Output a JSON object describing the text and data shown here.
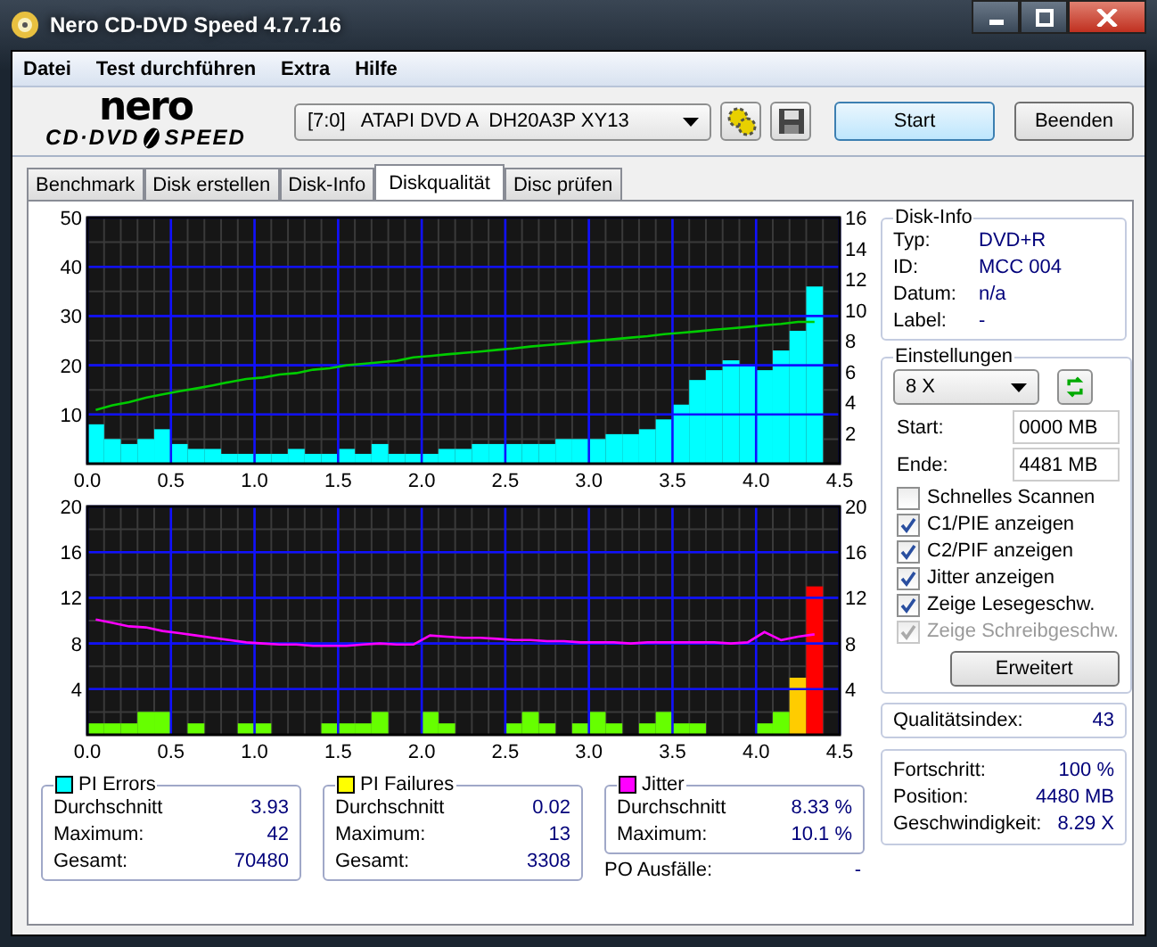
{
  "window": {
    "title": "Nero CD-DVD Speed 4.7.7.16"
  },
  "menu": [
    {
      "label": "Datei"
    },
    {
      "label": "Test durchführen"
    },
    {
      "label": "Extra"
    },
    {
      "label": "Hilfe"
    }
  ],
  "logo": {
    "top": "nero",
    "left": "CD·DVD",
    "right": "SPEED"
  },
  "toolbar": {
    "drive": "[7:0]   ATAPI DVD A  DH20A3P XY13",
    "start_button": "Start",
    "exit_button": "Beenden"
  },
  "tabs": [
    {
      "label": "Benchmark",
      "selected": false
    },
    {
      "label": "Disk erstellen",
      "selected": false
    },
    {
      "label": "Disk-Info",
      "selected": false
    },
    {
      "label": "Diskqualität",
      "selected": true
    },
    {
      "label": "Disc prüfen",
      "selected": false
    }
  ],
  "top_chart": {
    "right_ticks": [
      "16",
      "14",
      "12",
      "10",
      "8",
      "6",
      "4",
      "2"
    ],
    "chart_data": {
      "type": "bar",
      "grid": true,
      "xlim": [
        0,
        4.5
      ],
      "ylim": [
        0,
        50
      ],
      "xticks": [
        {
          "value": 0,
          "label": "0.0"
        },
        {
          "value": 0.5,
          "label": "0.5"
        },
        {
          "value": 1,
          "label": "1.0"
        },
        {
          "value": 1.5,
          "label": "1.5"
        },
        {
          "value": 2,
          "label": "2.0"
        },
        {
          "value": 2.5,
          "label": "2.5"
        },
        {
          "value": 3,
          "label": "3.0"
        },
        {
          "value": 3.5,
          "label": "3.5"
        },
        {
          "value": 4,
          "label": "4.0"
        },
        {
          "value": 4.5,
          "label": "4.5"
        }
      ],
      "yticks": [
        10,
        20,
        30,
        40,
        50
      ],
      "x": [
        0.05,
        0.15,
        0.25,
        0.35,
        0.45,
        0.55,
        0.65,
        0.75,
        0.85,
        0.95,
        1.05,
        1.15,
        1.25,
        1.35,
        1.45,
        1.55,
        1.65,
        1.75,
        1.85,
        1.95,
        2.05,
        2.15,
        2.25,
        2.35,
        2.45,
        2.55,
        2.65,
        2.75,
        2.85,
        2.95,
        3.05,
        3.15,
        3.25,
        3.35,
        3.45,
        3.55,
        3.65,
        3.75,
        3.85,
        3.95,
        4.05,
        4.15,
        4.25,
        4.35
      ],
      "series": [
        {
          "color": "#00ffff",
          "values": [
            8,
            5,
            4,
            5,
            7,
            4,
            3,
            3,
            2,
            2,
            2,
            2,
            3,
            2,
            2,
            3,
            2,
            4,
            2,
            2,
            2,
            3,
            3,
            4,
            4,
            4,
            4,
            4,
            5,
            5,
            5,
            6,
            6,
            7,
            9,
            12,
            17,
            19,
            21,
            20,
            19,
            23,
            27,
            36
          ]
        },
        {
          "type": "line",
          "color": "#00cc00",
          "values": [
            10.9,
            11.9,
            12.5,
            13.4,
            14.1,
            14.7,
            15.3,
            15.9,
            16.6,
            17.2,
            17.5,
            18.1,
            18.4,
            19.1,
            19.4,
            20.0,
            20.3,
            20.6,
            20.9,
            21.6,
            21.9,
            22.2,
            22.5,
            22.8,
            23.1,
            23.4,
            23.8,
            24.1,
            24.4,
            24.7,
            25.0,
            25.3,
            25.6,
            25.9,
            26.3,
            26.6,
            26.9,
            27.2,
            27.5,
            27.8,
            28.1,
            28.4,
            28.8,
            28.8
          ]
        }
      ]
    }
  },
  "bottom_chart": {
    "right_ticks": [
      "20",
      "16",
      "12",
      "8",
      "4"
    ],
    "chart_data": {
      "type": "bar",
      "grid": true,
      "xlim": [
        0,
        4.5
      ],
      "ylim": [
        0,
        20
      ],
      "xticks": [
        {
          "value": 0,
          "label": "0.0"
        },
        {
          "value": 0.5,
          "label": "0.5"
        },
        {
          "value": 1,
          "label": "1.0"
        },
        {
          "value": 1.5,
          "label": "1.5"
        },
        {
          "value": 2,
          "label": "2.0"
        },
        {
          "value": 2.5,
          "label": "2.5"
        },
        {
          "value": 3,
          "label": "3.0"
        },
        {
          "value": 3.5,
          "label": "3.5"
        },
        {
          "value": 4,
          "label": "4.0"
        },
        {
          "value": 4.5,
          "label": "4.5"
        }
      ],
      "yticks": [
        4,
        8,
        12,
        16,
        20
      ],
      "x": [
        0.05,
        0.15,
        0.25,
        0.35,
        0.45,
        0.55,
        0.65,
        0.75,
        0.85,
        0.95,
        1.05,
        1.15,
        1.25,
        1.35,
        1.45,
        1.55,
        1.65,
        1.75,
        1.85,
        1.95,
        2.05,
        2.15,
        2.25,
        2.35,
        2.45,
        2.55,
        2.65,
        2.75,
        2.85,
        2.95,
        3.05,
        3.15,
        3.25,
        3.35,
        3.45,
        3.55,
        3.65,
        3.75,
        3.85,
        3.95,
        4.05,
        4.15,
        4.25,
        4.35
      ],
      "series": [
        {
          "color": "#66ff00",
          "values": [
            1,
            1,
            1,
            2,
            2,
            0,
            1,
            0,
            0,
            1,
            1,
            0,
            0,
            0,
            1,
            1,
            1,
            2,
            0,
            0,
            2,
            1,
            0,
            0,
            0,
            1,
            2,
            1,
            0,
            1,
            2,
            1,
            0,
            1,
            2,
            1,
            1,
            0,
            0,
            0,
            1,
            2,
            null,
            null
          ]
        },
        {
          "color": "#ffcc00",
          "values": [
            null,
            null,
            null,
            null,
            null,
            null,
            null,
            null,
            null,
            null,
            null,
            null,
            null,
            null,
            null,
            null,
            null,
            null,
            null,
            null,
            null,
            null,
            null,
            null,
            null,
            null,
            null,
            null,
            null,
            null,
            null,
            null,
            null,
            null,
            null,
            null,
            null,
            null,
            null,
            null,
            null,
            null,
            5,
            null
          ]
        },
        {
          "color": "#ff0000",
          "values": [
            null,
            null,
            null,
            null,
            null,
            null,
            null,
            null,
            null,
            null,
            null,
            null,
            null,
            null,
            null,
            null,
            null,
            null,
            null,
            null,
            null,
            null,
            null,
            null,
            null,
            null,
            null,
            null,
            null,
            null,
            null,
            null,
            null,
            null,
            null,
            null,
            null,
            null,
            null,
            null,
            null,
            null,
            null,
            13
          ]
        },
        {
          "type": "line",
          "color": "#ff00ff",
          "values": [
            10.1,
            9.8,
            9.5,
            9.4,
            9.1,
            8.9,
            8.7,
            8.5,
            8.3,
            8.1,
            8.0,
            7.9,
            7.9,
            7.8,
            7.8,
            7.8,
            7.9,
            8.0,
            7.9,
            7.9,
            8.7,
            8.6,
            8.5,
            8.5,
            8.4,
            8.3,
            8.3,
            8.2,
            8.2,
            8.1,
            8.1,
            8.1,
            8.0,
            8.1,
            8.1,
            8.1,
            8.1,
            8.1,
            8.0,
            8.1,
            9.0,
            8.3,
            8.6,
            8.8
          ]
        }
      ]
    }
  },
  "disk_info": {
    "title": "Disk-Info",
    "fields": [
      {
        "label": "Typ:",
        "value": "DVD+R"
      },
      {
        "label": "ID:",
        "value": "MCC 004"
      },
      {
        "label": "Datum:",
        "value": "n/a"
      },
      {
        "label": "Label:",
        "value": "-"
      }
    ]
  },
  "settings": {
    "title": "Einstellungen",
    "speed": "8 X",
    "start": {
      "label": "Start:",
      "value": "0000 MB"
    },
    "end": {
      "label": "Ende:",
      "value": "4481 MB"
    },
    "checkboxes": [
      {
        "label": "Schnelles Scannen",
        "checked": false,
        "disabled": false
      },
      {
        "label": "C1/PIE anzeigen",
        "checked": true,
        "disabled": false
      },
      {
        "label": "C2/PIF anzeigen",
        "checked": true,
        "disabled": false
      },
      {
        "label": "Jitter anzeigen",
        "checked": true,
        "disabled": false
      },
      {
        "label": "Zeige Lesegeschw.",
        "checked": true,
        "disabled": false
      },
      {
        "label": "Zeige Schreibgeschw.",
        "checked": true,
        "disabled": true
      }
    ],
    "button": "Erweitert"
  },
  "quality": {
    "label": "Qualitätsindex:",
    "value": "43"
  },
  "stats": [
    {
      "title": "PI Errors",
      "color": "#00ffff",
      "rows": [
        {
          "label": "Durchschnitt",
          "value": "3.93"
        },
        {
          "label": "Maximum:",
          "value": "42"
        },
        {
          "label": "Gesamt:",
          "value": "70480"
        }
      ]
    },
    {
      "title": "PI Failures",
      "color": "#ffff00",
      "rows": [
        {
          "label": "Durchschnitt",
          "value": "0.02"
        },
        {
          "label": "Maximum:",
          "value": "13"
        },
        {
          "label": "Gesamt:",
          "value": "3308"
        }
      ]
    },
    {
      "title": "Jitter",
      "color": "#ff00ff",
      "rows": [
        {
          "label": "Durchschnitt",
          "value": "8.33 %"
        },
        {
          "label": "Maximum:",
          "value": "10.1 %"
        }
      ]
    }
  ],
  "po_failures": {
    "label": "PO Ausfälle:",
    "value": "-"
  },
  "progress": [
    {
      "label": "Fortschritt:",
      "value": "100 %"
    },
    {
      "label": "Position:",
      "value": "4480 MB"
    },
    {
      "label": "Geschwindigkeit:",
      "value": "8.29 X"
    }
  ]
}
